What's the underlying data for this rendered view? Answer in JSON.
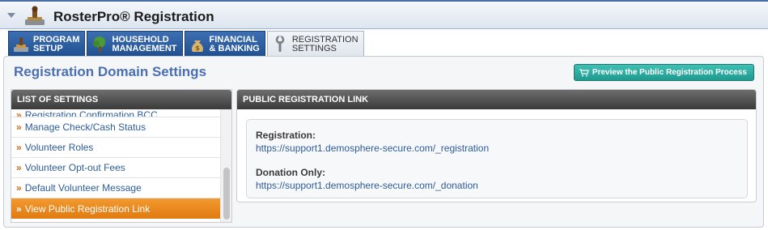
{
  "app": {
    "title": "RosterPro® Registration"
  },
  "tabs": [
    {
      "label": "PROGRAM\nSETUP",
      "icon": "stamp-icon",
      "active": false
    },
    {
      "label": "HOUSEHOLD\nMANAGEMENT",
      "icon": "tree-icon",
      "active": false
    },
    {
      "label": "FINANCIAL\n& BANKING",
      "icon": "money-bag-icon",
      "active": false
    },
    {
      "label": "REGISTRATION\nSETTINGS",
      "icon": "wrench-icon",
      "active": true
    }
  ],
  "page": {
    "title": "Registration Domain Settings",
    "preview_button": "Preview the Public Registration Process"
  },
  "settings_panel": {
    "header": "LIST OF SETTINGS",
    "items": [
      "Registration Confirmation BCC",
      "Manage Check/Cash Status",
      "Volunteer Roles",
      "Volunteer Opt-out Fees",
      "Default Volunteer Message",
      "View Public Registration Link"
    ],
    "selected_index": 5
  },
  "link_panel": {
    "header": "PUBLIC REGISTRATION LINK",
    "registration_label": "Registration:",
    "registration_url": "https://support1.demosphere-secure.com/_registration",
    "donation_label": "Donation Only:",
    "donation_url": "https://support1.demosphere-secure.com/_donation"
  },
  "colors": {
    "accent_blue": "#4a6fb3",
    "tab_blue": "#1f4f91",
    "selected_orange": "#e8861d",
    "preview_teal": "#26a79b",
    "link_blue": "#2d5c9a"
  }
}
